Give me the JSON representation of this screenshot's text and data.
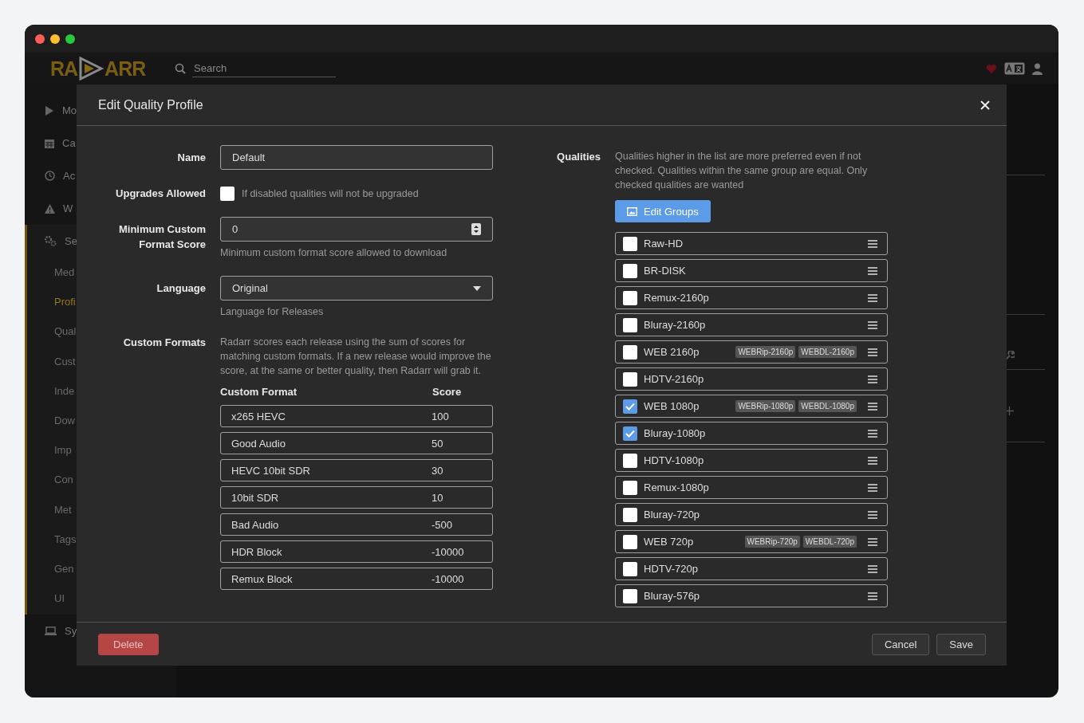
{
  "header": {
    "logo": {
      "left": "RA",
      "right": "ARR"
    },
    "search": {
      "placeholder": "Search"
    }
  },
  "sidebar": {
    "items": [
      {
        "label": "Mo",
        "kind": "play",
        "selected": false
      },
      {
        "label": "Ca",
        "kind": "calendar",
        "selected": false
      },
      {
        "label": "Ac",
        "kind": "clock",
        "selected": false
      },
      {
        "label": "W",
        "kind": "warning",
        "selected": false
      },
      {
        "label": "Se",
        "kind": "gears",
        "selected": true,
        "children": [
          {
            "label": "Med",
            "selected": false
          },
          {
            "label": "Profi",
            "selected": true
          },
          {
            "label": "Qual",
            "selected": false
          },
          {
            "label": "Cust",
            "selected": false
          },
          {
            "label": "Inde",
            "selected": false
          },
          {
            "label": "Dow",
            "selected": false
          },
          {
            "label": "Imp",
            "selected": false
          },
          {
            "label": "Con",
            "selected": false
          },
          {
            "label": "Met",
            "selected": false
          },
          {
            "label": "Tags",
            "selected": false
          },
          {
            "label": "Gen",
            "selected": false
          },
          {
            "label": "UI",
            "selected": false
          }
        ]
      },
      {
        "label": "Sy",
        "kind": "laptop",
        "selected": false
      }
    ]
  },
  "modal": {
    "title": "Edit Quality Profile",
    "name": {
      "label": "Name",
      "value": "Default"
    },
    "upgrades": {
      "label": "Upgrades Allowed",
      "checked": false,
      "help": "If disabled qualities will not be upgraded"
    },
    "min_score": {
      "label": "Minimum Custom Format Score",
      "value": "0",
      "help": "Minimum custom format score allowed to download"
    },
    "language": {
      "label": "Language",
      "value": "Original",
      "help": "Language for Releases"
    },
    "custom_formats": {
      "label": "Custom Formats",
      "help": "Radarr scores each release using the sum of scores for matching custom formats. If a new release would improve the score, at the same or better quality, then Radarr will grab it.",
      "columns": [
        "Custom Format",
        "Score"
      ],
      "rows": [
        {
          "name": "x265 HEVC",
          "score": "100"
        },
        {
          "name": "Good Audio",
          "score": "50"
        },
        {
          "name": "HEVC 10bit SDR",
          "score": "30"
        },
        {
          "name": "10bit SDR",
          "score": "10"
        },
        {
          "name": "Bad Audio",
          "score": "-500"
        },
        {
          "name": "HDR Block",
          "score": "-10000"
        },
        {
          "name": "Remux Block",
          "score": "-10000"
        }
      ]
    },
    "qualities": {
      "label": "Qualities",
      "help": "Qualities higher in the list are more preferred even if not checked. Qualities within the same group are equal. Only checked qualities are wanted",
      "edit_groups": "Edit Groups",
      "items": [
        {
          "name": "Raw-HD",
          "checked": false
        },
        {
          "name": "BR-DISK",
          "checked": false
        },
        {
          "name": "Remux-2160p",
          "checked": false
        },
        {
          "name": "Bluray-2160p",
          "checked": false
        },
        {
          "name": "WEB 2160p",
          "checked": false,
          "tags": [
            "WEBRip-2160p",
            "WEBDL-2160p"
          ]
        },
        {
          "name": "HDTV-2160p",
          "checked": false
        },
        {
          "name": "WEB 1080p",
          "checked": true,
          "tags": [
            "WEBRip-1080p",
            "WEBDL-1080p"
          ]
        },
        {
          "name": "Bluray-1080p",
          "checked": true
        },
        {
          "name": "HDTV-1080p",
          "checked": false
        },
        {
          "name": "Remux-1080p",
          "checked": false
        },
        {
          "name": "Bluray-720p",
          "checked": false
        },
        {
          "name": "WEB 720p",
          "checked": false,
          "tags": [
            "WEBRip-720p",
            "WEBDL-720p"
          ]
        },
        {
          "name": "HDTV-720p",
          "checked": false
        },
        {
          "name": "Bluray-576p",
          "checked": false
        }
      ]
    },
    "footer": {
      "delete": "Delete",
      "cancel": "Cancel",
      "save": "Save"
    }
  }
}
